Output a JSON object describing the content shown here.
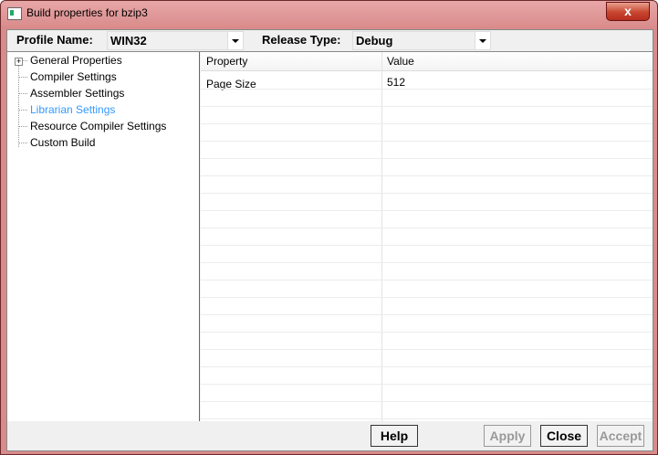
{
  "window": {
    "title": "Build properties for bzip3",
    "close_label": "x"
  },
  "toolbar": {
    "profile_label": "Profile Name:",
    "profile_value": "WIN32",
    "release_label": "Release Type:",
    "release_value": "Debug"
  },
  "tree": {
    "items": [
      {
        "label": "General Properties",
        "expand": "+"
      },
      {
        "label": "Compiler Settings"
      },
      {
        "label": "Assembler Settings"
      },
      {
        "label": "Librarian Settings",
        "selected": true
      },
      {
        "label": "Resource Compiler Settings"
      },
      {
        "label": "Custom Build"
      }
    ]
  },
  "grid": {
    "col_property": "Property",
    "col_value": "Value",
    "rows": [
      {
        "property": "Page Size",
        "value": "512"
      }
    ]
  },
  "buttons": {
    "help": "Help",
    "apply": "Apply",
    "close": "Close",
    "accept": "Accept"
  },
  "colors": {
    "selected_text": "#3399ff",
    "titlebar": "#d98b8b",
    "close_button": "#c84630"
  }
}
